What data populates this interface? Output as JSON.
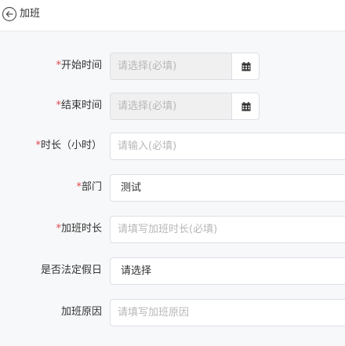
{
  "header": {
    "title": "加班",
    "back_icon": "back-arrow-circle-icon"
  },
  "form": {
    "start_time": {
      "required": "*",
      "label": "开始时间",
      "placeholder": "请选择(必填)",
      "icon": "calendar-icon"
    },
    "end_time": {
      "required": "*",
      "label": "结束时间",
      "placeholder": "请选择(必填)",
      "icon": "calendar-icon"
    },
    "duration": {
      "required": "*",
      "label": "时长（小时）",
      "placeholder": "请输入(必填)"
    },
    "department": {
      "required": "*",
      "label": "部门",
      "value": "测试"
    },
    "overtime_hours": {
      "required": "*",
      "label": "加班时长",
      "placeholder": "请填写加班时长(必填)"
    },
    "legal_holiday": {
      "label": "是否法定假日",
      "value": "请选择"
    },
    "reason": {
      "label": "加班原因",
      "placeholder": "请填写加班原因"
    }
  }
}
